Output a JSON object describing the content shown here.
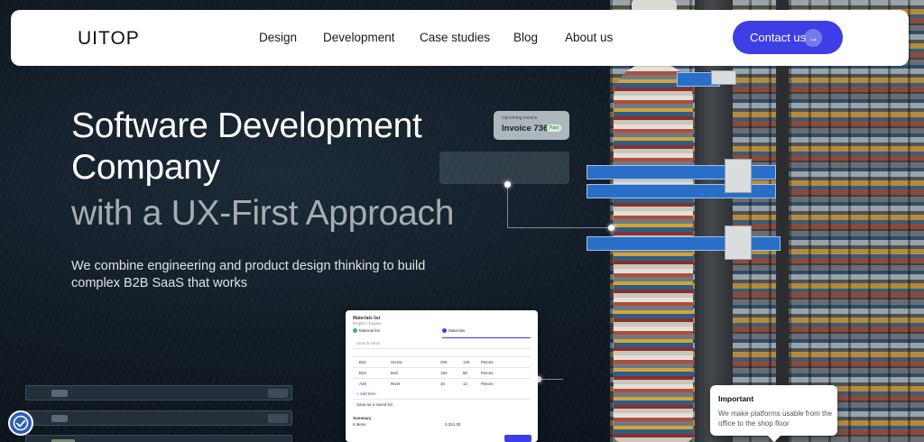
{
  "nav": {
    "logo": "UITOP",
    "links": [
      "Design",
      "Development",
      "Case studies",
      "Blog",
      "About us"
    ],
    "contact_label": "Contact us"
  },
  "hero": {
    "line1": "Software Development",
    "line2": "Company",
    "line3": "with a UX-First Approach",
    "subtitle": "We combine engineering and product design thinking to build complex B2B SaaS that works"
  },
  "invoice_chip": {
    "caption": "Upcoming invoice",
    "title": "Invoice 736",
    "status": "Paid"
  },
  "form_mock": {
    "title": "Materials list",
    "subtitle": "Project / Engine",
    "step1": "Material list",
    "step2": "Materials",
    "search": "Search items",
    "rows": [
      [
        "B21",
        "Screw",
        "200",
        "140",
        "Pieces"
      ],
      [
        "B22",
        "Bolt",
        "150",
        "80",
        "Pieces"
      ],
      [
        "A40",
        "Rivet",
        "10",
        "12",
        "Pieces"
      ]
    ],
    "add": "+ Add Item",
    "save_title": "Save as a saved list",
    "summary": "Summary",
    "items_count": "6 items",
    "total": "2,341.00"
  },
  "important_card": {
    "title": "Important",
    "body": "We make platforms usable from the office to the shop floor"
  },
  "icons": {
    "contact_arrow": "arrow-right-icon",
    "accessibility": "accessibility-icon"
  },
  "colors": {
    "accent": "#3d3ee6",
    "background": "#0e1620",
    "headline_muted": "#a6adb3"
  }
}
